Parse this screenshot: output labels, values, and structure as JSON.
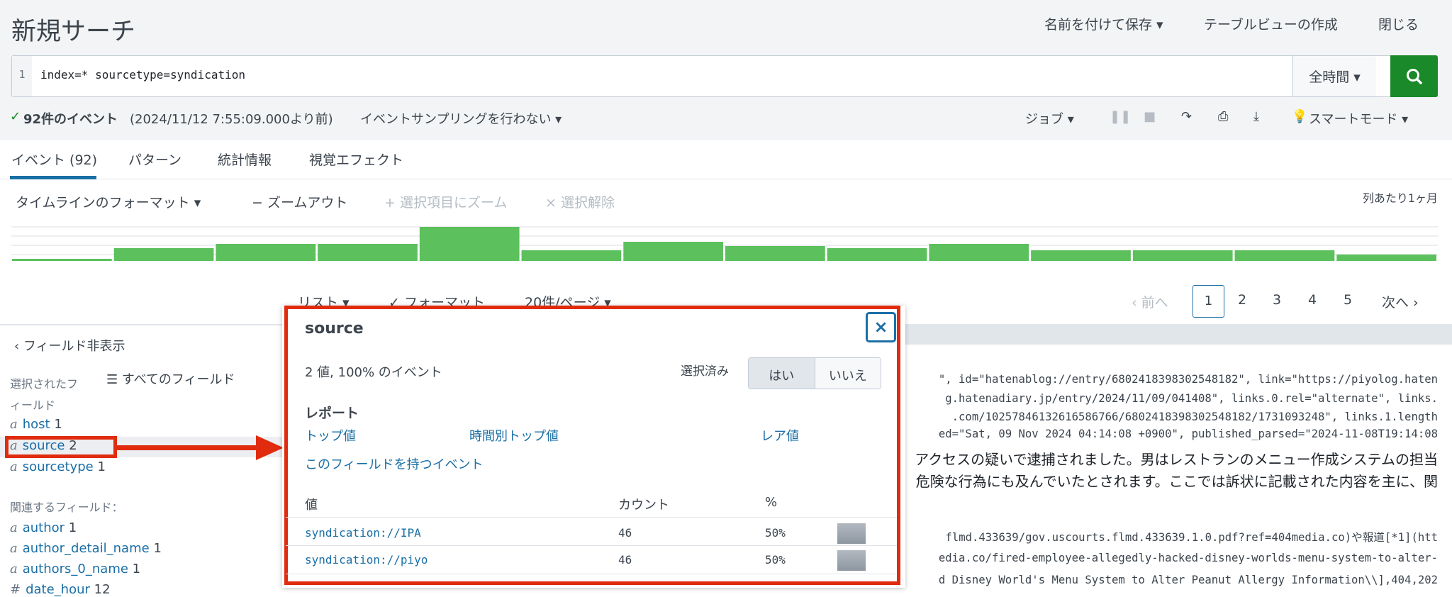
{
  "header": {
    "title": "新規サーチ",
    "save_as": "名前を付けて保存 ▾",
    "create_table_view": "テーブルビューの作成",
    "close": "閉じる"
  },
  "search": {
    "line_number": "1",
    "query": "index=* sourcetype=syndication",
    "time_range": "全時間 ▾",
    "search_icon": "search-icon"
  },
  "status": {
    "check": "✓",
    "count": "92件のイベント",
    "before": "(2024/11/12 7:55:09.000より前)",
    "sampling": "イベントサンプリングを行わない ▾",
    "job": "ジョブ ▾",
    "smart_mode": "スマートモード ▾"
  },
  "tabs": [
    {
      "label": "イベント (92)",
      "active": true
    },
    {
      "label": "パターン"
    },
    {
      "label": "統計情報"
    },
    {
      "label": "視覚エフェクト"
    }
  ],
  "timeline": {
    "format": "タイムラインのフォーマット ▾",
    "zoom_out": "− ズームアウト",
    "zoom_selection": "+ 選択項目にズーム",
    "deselect": "× 選択解除",
    "scale": "列あたり1ヶ月",
    "bar_color": "#5cc05c",
    "counts": [
      1,
      6,
      8,
      8,
      16,
      5,
      9,
      7,
      6,
      8,
      5,
      5,
      5,
      3
    ]
  },
  "results_bar": {
    "list": "リスト ▾",
    "format": "✓ フォーマット",
    "per_page": "20件/ページ ▾",
    "prev": "‹ 前へ",
    "pages": [
      "1",
      "2",
      "3",
      "4",
      "5"
    ],
    "current_page": "1",
    "next": "次へ ›"
  },
  "sidebar": {
    "hide_fields": "‹ フィールド非表示",
    "all_fields": "すべてのフィールド",
    "selected_label_1": "選択されたフ",
    "selected_label_2": "ィールド",
    "selected": [
      {
        "type": "a",
        "name": "host",
        "count": "1"
      },
      {
        "type": "a",
        "name": "source",
        "count": "2"
      },
      {
        "type": "a",
        "name": "sourcetype",
        "count": "1"
      }
    ],
    "related_label": "関連するフィールド：",
    "related": [
      {
        "type": "a",
        "name": "author",
        "count": "1"
      },
      {
        "type": "a",
        "name": "author_detail_name",
        "count": "1"
      },
      {
        "type": "a",
        "name": "authors_0_name",
        "count": "1"
      },
      {
        "type": "#",
        "name": "date_hour",
        "count": "12"
      }
    ]
  },
  "events": [
    "\", id=\"hatenablog://entry/6802418398302548182\", link=\"https://piyolog.haten",
    "g.hatenadiary.jp/entry/2024/11/09/041408\", links.0.rel=\"alternate\", links.",
    ".com/10257846132616586766/6802418398302548182/1731093248\", links.1.length",
    "ed=\"Sat, 09 Nov 2024 04:14:08 +0900\", published_parsed=\"2024-11-08T19:14:08",
    "アクセスの疑いで逮捕されました。男はレストランのメニュー作成システムの担当",
    "危険な行為にも及んでいたとされます。ここでは訴状に記載された内容を主に、関",
    "flmd.433639/gov.uscourts.flmd.433639.1.0.pdf?ref=404media.co)や報道[*1](htt",
    "edia.co/fired-employee-allegedly-hacked-disney-worlds-menu-system-to-alter-",
    "d Disney World's Menu System to Alter Peanut Allergy Information\\\\],404,202"
  ],
  "popup": {
    "title": "source",
    "summary": "2 値, 100% のイベント",
    "selected_label": "選択済み",
    "yes": "はい",
    "no": "いいえ",
    "reports_label": "レポート",
    "top_values": "トップ値",
    "top_values_by_time": "時間別トップ値",
    "rare_values": "レア値",
    "events_with_field": "このフィールドを持つイベント",
    "columns": {
      "value": "値",
      "count": "カウント",
      "percent": "%"
    },
    "rows": [
      {
        "value": "syndication://IPA",
        "count": "46",
        "percent": "50%"
      },
      {
        "value": "syndication://piyo",
        "count": "46",
        "percent": "50%"
      }
    ],
    "close": "×"
  },
  "colors": {
    "accent": "#1a6fa6",
    "search_button": "#1a8929",
    "annotation": "#e02b0e"
  }
}
